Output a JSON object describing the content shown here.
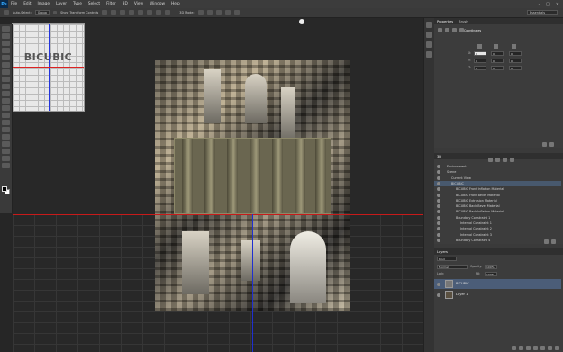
{
  "app": {
    "logo": "Ps"
  },
  "menu": [
    "File",
    "Edit",
    "Image",
    "Layer",
    "Type",
    "Select",
    "Filter",
    "3D",
    "View",
    "Window",
    "Help"
  ],
  "options_bar": {
    "auto_select_label": "Auto-Select:",
    "auto_select_value": "Group",
    "show_transform_label": "Show Transform Controls",
    "mode_label": "3D Mode:",
    "workspace": "Essentials"
  },
  "preview": {
    "text": "BICUBIC"
  },
  "properties": {
    "tabs": [
      "Properties",
      "Brush"
    ],
    "section_title": "Coordinates",
    "rows": [
      {
        "label": "X:",
        "values": [
          "0",
          "0",
          "0"
        ]
      },
      {
        "label": "Y:",
        "values": [
          "0",
          "0",
          "0"
        ]
      },
      {
        "label": "Z:",
        "values": [
          "0",
          "0",
          "0"
        ]
      }
    ]
  },
  "scene": {
    "tab": "3D",
    "items": [
      {
        "label": "Environment",
        "indent": 0,
        "selected": false
      },
      {
        "label": "Scene",
        "indent": 0,
        "selected": false
      },
      {
        "label": "Current View",
        "indent": 1,
        "selected": false
      },
      {
        "label": "BICUBIC",
        "indent": 1,
        "selected": true
      },
      {
        "label": "BICUBIC Front Inflation Material",
        "indent": 2,
        "selected": false
      },
      {
        "label": "BICUBIC Front Bevel Material",
        "indent": 2,
        "selected": false
      },
      {
        "label": "BICUBIC Extrusion Material",
        "indent": 2,
        "selected": false
      },
      {
        "label": "BICUBIC Back Bevel Material",
        "indent": 2,
        "selected": false
      },
      {
        "label": "BICUBIC Back Inflation Material",
        "indent": 2,
        "selected": false
      },
      {
        "label": "Boundary Constraint 1",
        "indent": 2,
        "selected": false
      },
      {
        "label": "Internal Constraint 1",
        "indent": 3,
        "selected": false
      },
      {
        "label": "Internal Constraint 2",
        "indent": 3,
        "selected": false
      },
      {
        "label": "Internal Constraint 3",
        "indent": 3,
        "selected": false
      },
      {
        "label": "Boundary Constraint 4",
        "indent": 2,
        "selected": false
      }
    ]
  },
  "layers": {
    "tab": "Layers",
    "kind_label": "Kind",
    "blend_mode": "Normal",
    "opacity_label": "Opacity:",
    "opacity_value": "100%",
    "lock_label": "Lock:",
    "fill_label": "Fill:",
    "fill_value": "100%",
    "items": [
      {
        "name": "BICUBIC",
        "selected": true
      },
      {
        "name": "Layer 1",
        "selected": false
      }
    ]
  },
  "colors": {
    "accent_blue": "#31a8ff",
    "guide_red": "#c81a1a",
    "guide_blue": "#1f2fd0"
  }
}
